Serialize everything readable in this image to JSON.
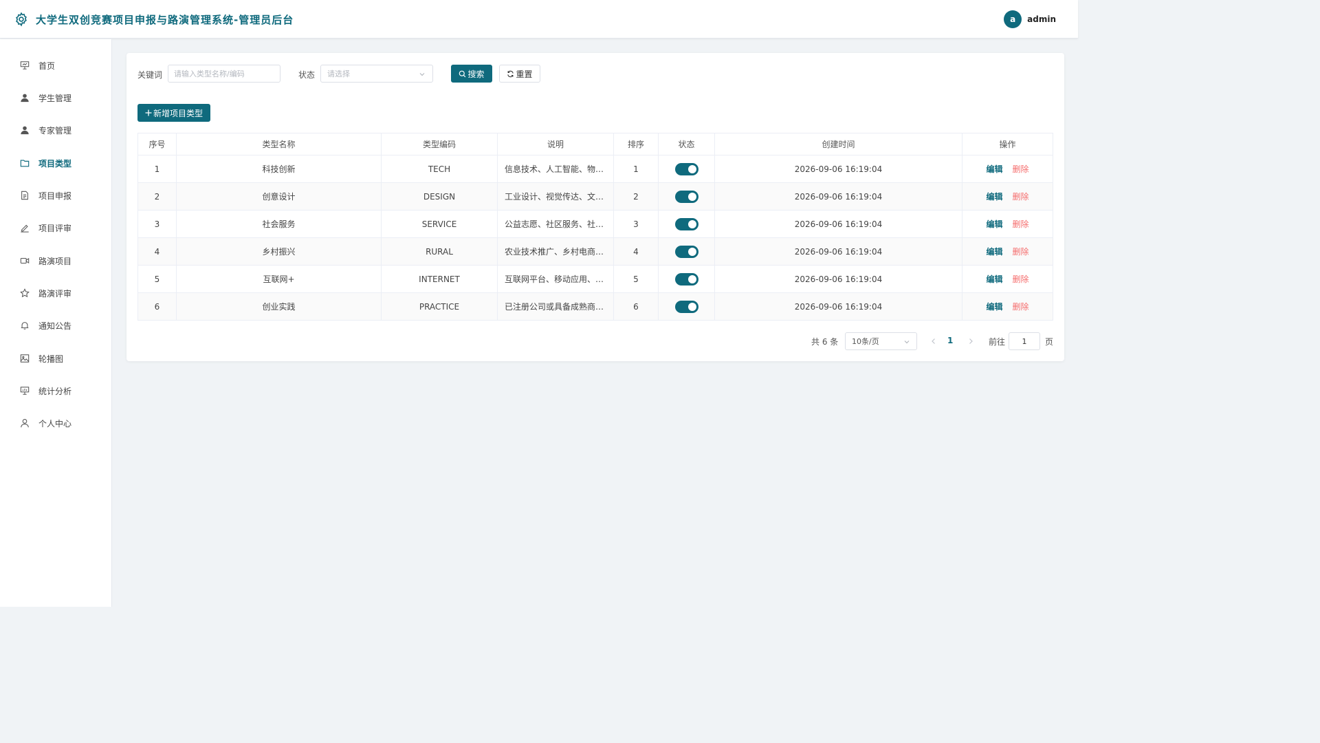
{
  "header": {
    "title": "大学生双创竞赛项目申报与路演管理系统-管理员后台",
    "avatar_letter": "a",
    "username": "admin"
  },
  "sidebar": {
    "items": [
      {
        "label": "首页",
        "icon": "presentation-icon"
      },
      {
        "label": "学生管理",
        "icon": "user-filled-icon"
      },
      {
        "label": "专家管理",
        "icon": "user-filled-icon"
      },
      {
        "label": "项目类型",
        "icon": "folder-icon",
        "active": true
      },
      {
        "label": "项目申报",
        "icon": "document-icon"
      },
      {
        "label": "项目评审",
        "icon": "edit-pen-icon"
      },
      {
        "label": "路演项目",
        "icon": "video-camera-icon"
      },
      {
        "label": "路演评审",
        "icon": "star-icon"
      },
      {
        "label": "通知公告",
        "icon": "bell-icon"
      },
      {
        "label": "轮播图",
        "icon": "picture-icon"
      },
      {
        "label": "统计分析",
        "icon": "chart-board-icon"
      },
      {
        "label": "个人中心",
        "icon": "user-outline-icon"
      }
    ]
  },
  "filters": {
    "keyword_label": "关键词",
    "keyword_placeholder": "请输入类型名称/编码",
    "status_label": "状态",
    "status_placeholder": "请选择",
    "search_label": "搜索",
    "reset_label": "重置"
  },
  "actions": {
    "add_label": "新增项目类型"
  },
  "table": {
    "columns": [
      "序号",
      "类型名称",
      "类型编码",
      "说明",
      "排序",
      "状态",
      "创建时间",
      "操作"
    ],
    "rows": [
      {
        "index": "1",
        "name": "科技创新",
        "code": "TECH",
        "desc": "信息技术、人工智能、物…",
        "sort": "1",
        "enabled": true,
        "created": "2026-09-06 16:19:04"
      },
      {
        "index": "2",
        "name": "创意设计",
        "code": "DESIGN",
        "desc": "工业设计、视觉传达、文…",
        "sort": "2",
        "enabled": true,
        "created": "2026-09-06 16:19:04"
      },
      {
        "index": "3",
        "name": "社会服务",
        "code": "SERVICE",
        "desc": "公益志愿、社区服务、社…",
        "sort": "3",
        "enabled": true,
        "created": "2026-09-06 16:19:04"
      },
      {
        "index": "4",
        "name": "乡村振兴",
        "code": "RURAL",
        "desc": "农业技术推广、乡村电商…",
        "sort": "4",
        "enabled": true,
        "created": "2026-09-06 16:19:04"
      },
      {
        "index": "5",
        "name": "互联网+",
        "code": "INTERNET",
        "desc": "互联网平台、移动应用、…",
        "sort": "5",
        "enabled": true,
        "created": "2026-09-06 16:19:04"
      },
      {
        "index": "6",
        "name": "创业实践",
        "code": "PRACTICE",
        "desc": "已注册公司或具备成熟商…",
        "sort": "6",
        "enabled": true,
        "created": "2026-09-06 16:19:04"
      }
    ],
    "edit_label": "编辑",
    "delete_label": "删除"
  },
  "pagination": {
    "total_text": "共 6 条",
    "page_size": "10条/页",
    "current_page": "1",
    "goto_label": "前往",
    "goto_value": "1",
    "page_suffix": "页"
  },
  "colors": {
    "brand": "#0f6a7d",
    "danger": "#f56c6c",
    "background": "#f0f3f6"
  }
}
